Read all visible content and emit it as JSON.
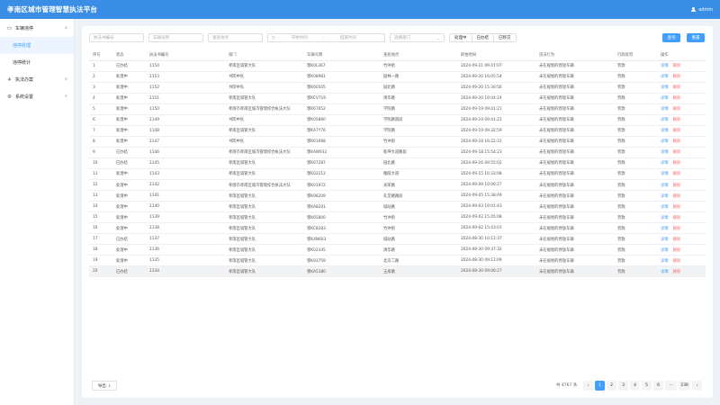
{
  "header": {
    "title": "孝南区城市管理智慧执法平台",
    "user": "admin"
  },
  "sidebar": {
    "groups": [
      {
        "label": "车辆违停",
        "icon": "car-icon",
        "arrow": "∧"
      },
      {
        "label": "执法办案",
        "icon": "plane-icon",
        "arrow": "∨"
      },
      {
        "label": "系统设置",
        "icon": "gear-icon",
        "arrow": "∨"
      }
    ],
    "sub_items": [
      {
        "label": "违停处理"
      },
      {
        "label": "违停统计"
      }
    ]
  },
  "filters": {
    "doc_no_placeholder": "执法书编号",
    "plate_placeholder": "车辆号牌",
    "location_placeholder": "查处地点",
    "start_placeholder": "开始时间",
    "range_sep": "-",
    "end_placeholder": "结束时间",
    "dept_placeholder": "选择部门",
    "status_options": [
      "处理中",
      "已办结",
      "已移交"
    ],
    "search_label": "查询",
    "reset_label": "重置"
  },
  "table": {
    "columns": [
      "序号",
      "状态",
      "执法书编号",
      "部门",
      "车辆号牌",
      "查处地点",
      "抓拍时间",
      "违法行为",
      "行政处罚",
      "操作"
    ],
    "edit_label": "详情",
    "delete_label": "删除",
    "rows": [
      [
        "1",
        "已办结",
        "1154",
        "孝南区城管大队",
        "鄂K0L367",
        "竹冲街",
        "2024-09-21 09:47:07",
        "未在规划的停放车辆",
        "罚款"
      ],
      [
        "2",
        "处理中",
        "1153",
        "书院中队",
        "鄂K08981",
        "园林一路",
        "2024-09-20 16:05:54",
        "未在规划的停放车辆",
        "罚款"
      ],
      [
        "3",
        "处理中",
        "1152",
        "书院中队",
        "鄂K60505",
        "园北路",
        "2024-09-20 15:30:56",
        "未在规划的停放车辆",
        "罚款"
      ],
      [
        "4",
        "处理中",
        "1151",
        "孝南区城管大队",
        "鄂KCV719",
        "清华路",
        "2024-09-20 10:04:24",
        "未在规划的停放车辆",
        "罚款"
      ],
      [
        "5",
        "处理中",
        "1150",
        "孝感市孝南区城市管理综合执法大队",
        "鄂K67652",
        "学院路",
        "2024-09-19 09:41:21",
        "未在规划的停放车辆",
        "罚款"
      ],
      [
        "6",
        "处理中",
        "1149",
        "书院中队",
        "鄂K05860",
        "学院路南段",
        "2024-09-19 09:41:21",
        "未在规划的停放车辆",
        "罚款"
      ],
      [
        "7",
        "处理中",
        "1148",
        "孝南区城管大队",
        "鄂KA7Y76",
        "学院路",
        "2024-09-19 09:32:59",
        "未在规划的停放车辆",
        "罚款"
      ],
      [
        "8",
        "处理中",
        "1147",
        "书院中队",
        "鄂K61668",
        "竹冲街",
        "2024-09-18 16:22:31",
        "未在规划的停放车辆",
        "罚款"
      ],
      [
        "9",
        "已办结",
        "1146",
        "孝感市孝南区城市管理综合执法大队",
        "鄂KAW932",
        "乾坤大道路段",
        "2024-09-18 15:54:23",
        "未在规划的停放车辆",
        "罚款"
      ],
      [
        "10",
        "已办结",
        "1145",
        "孝南区城管大队",
        "鄂K67287",
        "园北路",
        "2024-09-16 09:55:02",
        "未在规划的停放车辆",
        "罚款"
      ],
      [
        "11",
        "处理中",
        "1143",
        "孝南区城管大队",
        "鄂K02212",
        "槐荫大道",
        "2024-09-15 10:33:08",
        "未在规划的停放车辆",
        "罚款"
      ],
      [
        "12",
        "处理中",
        "1142",
        "孝感市孝南区城市管理综合执法大队",
        "鄂K01972",
        "光荣路",
        "2024-09-09 10:06:27",
        "未在规划的停放车辆",
        "罚款"
      ],
      [
        "13",
        "处理中",
        "1141",
        "孝南区城管大队",
        "鄂K98209",
        "孔堂路路段",
        "2024-09-05 15:38:49",
        "未在规划的停放车辆",
        "罚款"
      ],
      [
        "14",
        "处理中",
        "1140",
        "孝南区城管大队",
        "鄂KA8201",
        "城站路",
        "2024-09-03 10:01:43",
        "未在规划的停放车辆",
        "罚款"
      ],
      [
        "15",
        "处理中",
        "1139",
        "孝南区城管大队",
        "鄂K65800",
        "竹冲街",
        "2024-09-02 15:45:08",
        "未在规划的停放车辆",
        "罚款"
      ],
      [
        "16",
        "处理中",
        "1138",
        "孝南区城管大队",
        "鄂KC8283",
        "竹冲街",
        "2024-09-02 15:43:01",
        "未在规划的停放车辆",
        "罚款"
      ],
      [
        "17",
        "已办结",
        "1137",
        "孝南区城管大队",
        "鄂K4N603",
        "城站路",
        "2024-08-30 10:12:37",
        "未在规划的停放车辆",
        "罚款"
      ],
      [
        "18",
        "处理中",
        "1136",
        "孝南区城管大队",
        "鄂K02345",
        "清华路",
        "2024-08-30 09:37:32",
        "未在规划的停放车辆",
        "罚款"
      ],
      [
        "19",
        "处理中",
        "1135",
        "孝南区城管大队",
        "鄂K93759",
        "北京二路",
        "2024-08-30 09:12:09",
        "未在规划的停放车辆",
        "罚款"
      ],
      [
        "20",
        "已办结",
        "1134",
        "孝南区城管大队",
        "鄂KA5180",
        "玉泉路",
        "2024-08-30 09:06:27",
        "未在规划的停放车辆",
        "罚款"
      ]
    ]
  },
  "footer": {
    "export_label": "导出",
    "total_text": "共 4767 条",
    "pages": [
      "1",
      "2",
      "3",
      "4",
      "5",
      "6",
      "···",
      "239"
    ],
    "prev": "‹",
    "next": "›",
    "current_page": "1"
  },
  "colors": {
    "primary": "#409eff",
    "header": "#3a8ee6",
    "danger": "#f56c6c"
  }
}
